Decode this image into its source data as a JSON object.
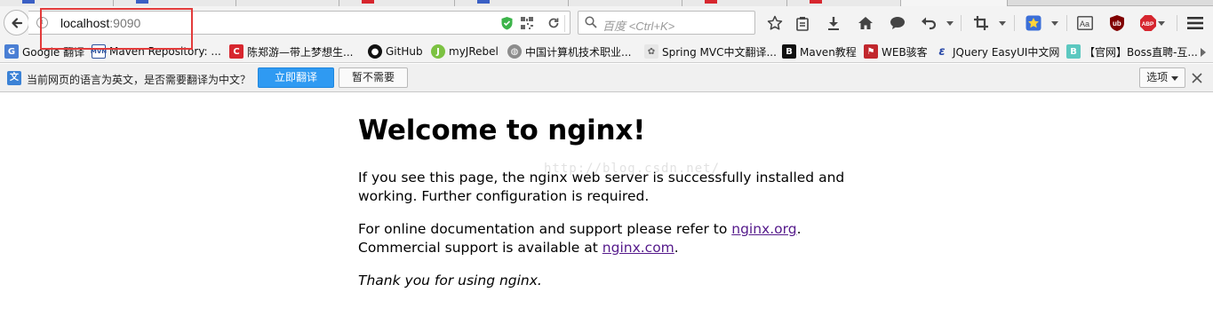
{
  "browser": {
    "address_bar": {
      "host": "localhost",
      "port": ":9090"
    },
    "search_bar": {
      "placeholder": "百度 <Ctrl+K>"
    }
  },
  "bookmarks": [
    {
      "label": "Google 翻译",
      "icon": "google-translate-icon",
      "color": "#4a7fd4"
    },
    {
      "label": "Maven Repository: ...",
      "icon": "maven-repo-icon",
      "color": "#2b4f9c"
    },
    {
      "label": "陈郑游—带上梦想生...",
      "icon": "c-red-icon",
      "color": "#d7262e"
    },
    {
      "label": "GitHub",
      "icon": "github-icon",
      "color": "#111111"
    },
    {
      "label": "myJRebel",
      "icon": "jrebel-icon",
      "color": "#7cc242"
    },
    {
      "label": "中国计算机技术职业...",
      "icon": "globe-icon",
      "color": "#777777"
    },
    {
      "label": "Spring MVC中文翻译...",
      "icon": "spring-icon",
      "color": "#999999"
    },
    {
      "label": "Maven教程",
      "icon": "b-black-icon",
      "color": "#111111"
    },
    {
      "label": "WEB骇客",
      "icon": "web-hacker-icon",
      "color": "#c1272d"
    },
    {
      "label": "JQuery EasyUI中文网",
      "icon": "easyui-icon",
      "color": "#2a4aa8"
    },
    {
      "label": "【官网】Boss直聘-互...",
      "icon": "boss-icon",
      "color": "#5cc8c0"
    }
  ],
  "translate_bar": {
    "message": "当前网页的语言为英文，是否需要翻译为中文？",
    "translate_button": "立即翻译",
    "no_button": "暂不需要",
    "options_button": "选项"
  },
  "page": {
    "heading": "Welcome to nginx!",
    "para1_line1": "If you see this page, the nginx web server is successfully installed and",
    "para1_line2": "working. Further configuration is required.",
    "para2_prefix": "For online documentation and support please refer to ",
    "link_org": "nginx.org",
    "para2_period": ".",
    "para3_prefix": "Commercial support is available at ",
    "link_com": "nginx.com",
    "para3_period": ".",
    "thanks": "Thank you for using nginx."
  },
  "watermark": "http://blog.csdn.net/",
  "colors": {
    "highlight_box": "#e33b3b",
    "translate_button": "#2f9af2",
    "visited_link": "#551a8b"
  }
}
